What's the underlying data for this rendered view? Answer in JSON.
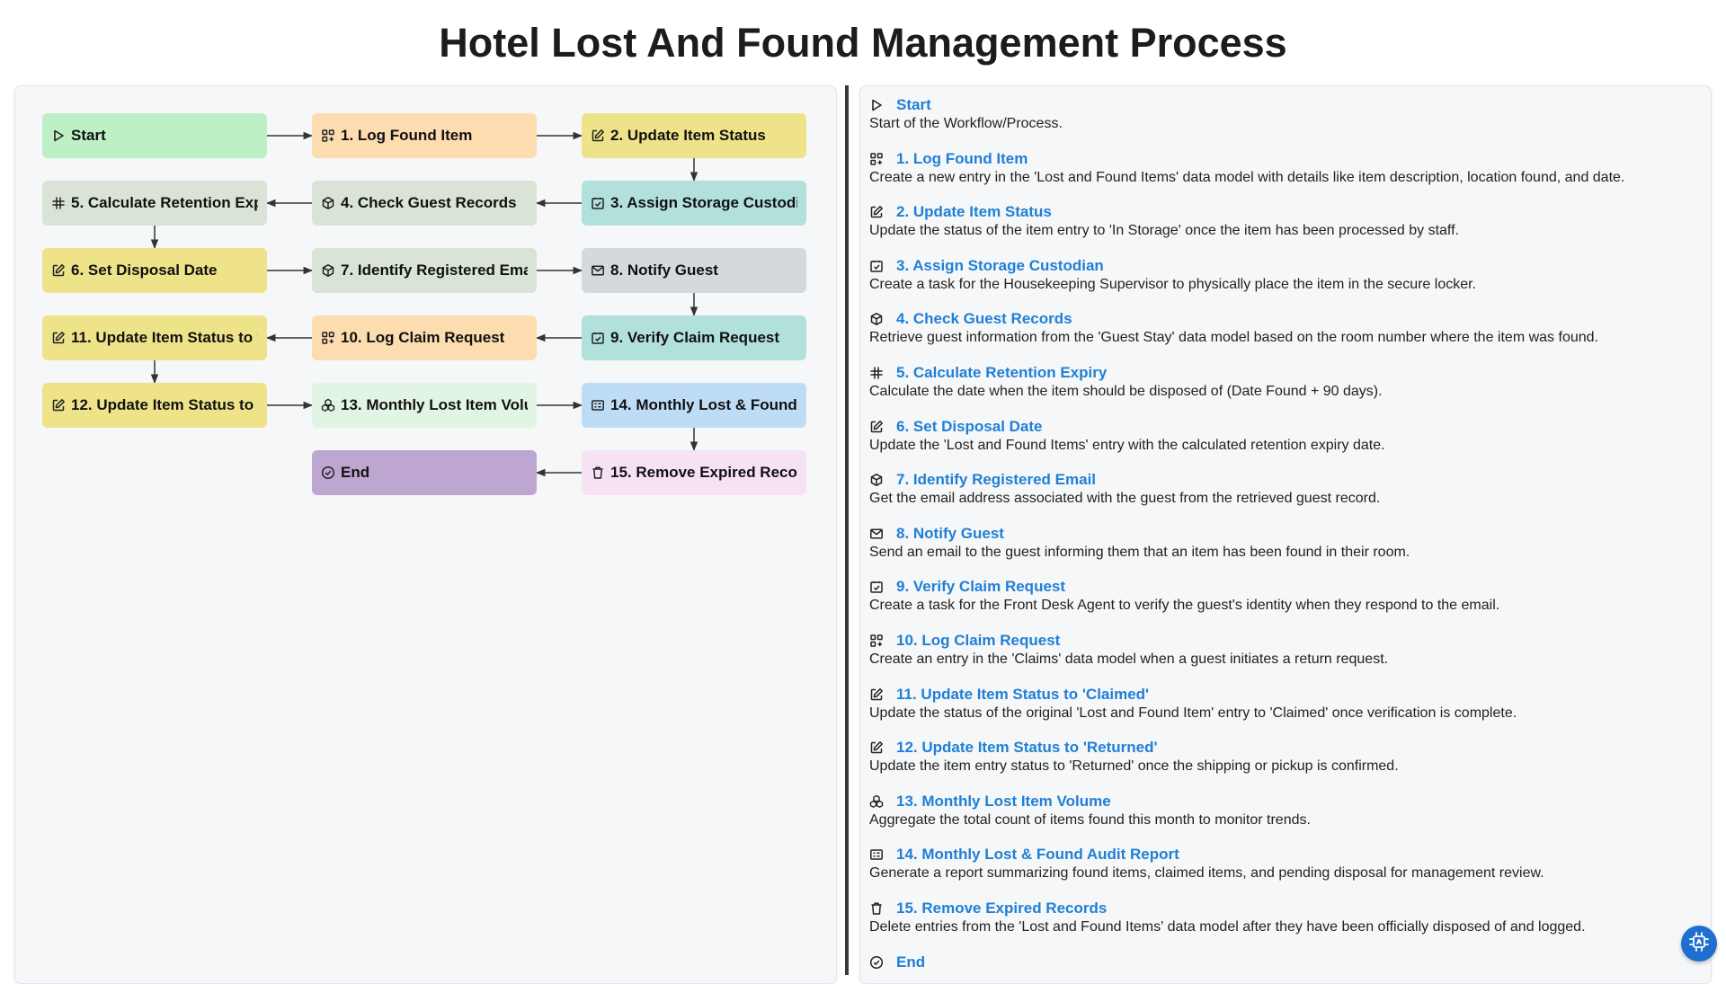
{
  "title": "Hotel Lost And Found Management Process",
  "colors": {
    "green": "#bdf0c4",
    "orange": "#fddcb0",
    "yellow": "#efe38a",
    "teal": "#b2e0da",
    "sage": "#d9e4d6",
    "gray": "#d4d9dd",
    "mint": "#e2f4e4",
    "blue": "#bfdcf7",
    "pink": "#f7e2f4",
    "purple": "#bda6d0",
    "link": "#1f7fd6"
  },
  "nodes": [
    {
      "id": "start",
      "label": "Start",
      "icon": "play-icon",
      "color": "green"
    },
    {
      "id": "n1",
      "label": "1. Log Found Item",
      "icon": "grid-plus-icon",
      "color": "orange"
    },
    {
      "id": "n2",
      "label": "2. Update Item Status",
      "icon": "edit-icon",
      "color": "yellow"
    },
    {
      "id": "n3",
      "label": "3. Assign Storage Custodian",
      "icon": "check-square-icon",
      "color": "teal"
    },
    {
      "id": "n4",
      "label": "4. Check Guest Records",
      "icon": "cube-icon",
      "color": "sage"
    },
    {
      "id": "n5",
      "label": "5. Calculate Retention Expiry",
      "icon": "hash-icon",
      "color": "sage"
    },
    {
      "id": "n6",
      "label": "6. Set Disposal Date",
      "icon": "edit-icon",
      "color": "yellow"
    },
    {
      "id": "n7",
      "label": "7. Identify Registered Email",
      "icon": "cube-icon",
      "color": "sage"
    },
    {
      "id": "n8",
      "label": "8. Notify Guest",
      "icon": "mail-icon",
      "color": "gray"
    },
    {
      "id": "n9",
      "label": "9. Verify Claim Request",
      "icon": "check-square-icon",
      "color": "teal"
    },
    {
      "id": "n10",
      "label": "10. Log Claim Request",
      "icon": "grid-plus-icon",
      "color": "orange"
    },
    {
      "id": "n11",
      "label": "11. Update Item Status to 'Claimed'",
      "icon": "edit-icon",
      "color": "yellow"
    },
    {
      "id": "n12",
      "label": "12. Update Item Status to 'Returned'",
      "icon": "edit-icon",
      "color": "yellow"
    },
    {
      "id": "n13",
      "label": "13. Monthly Lost Item Volume",
      "icon": "boxes-icon",
      "color": "mint"
    },
    {
      "id": "n14",
      "label": "14. Monthly Lost & Found Audit Report",
      "icon": "report-icon",
      "color": "blue"
    },
    {
      "id": "n15",
      "label": "15. Remove Expired Records",
      "icon": "trash-icon",
      "color": "pink"
    },
    {
      "id": "end",
      "label": "End",
      "icon": "check-circle-icon",
      "color": "purple"
    }
  ],
  "edges": [
    [
      "start",
      "n1"
    ],
    [
      "n1",
      "n2"
    ],
    [
      "n2",
      "n3"
    ],
    [
      "n3",
      "n4"
    ],
    [
      "n4",
      "n5"
    ],
    [
      "n5",
      "n6"
    ],
    [
      "n6",
      "n7"
    ],
    [
      "n7",
      "n8"
    ],
    [
      "n8",
      "n9"
    ],
    [
      "n9",
      "n10"
    ],
    [
      "n10",
      "n11"
    ],
    [
      "n11",
      "n12"
    ],
    [
      "n12",
      "n13"
    ],
    [
      "n13",
      "n14"
    ],
    [
      "n14",
      "n15"
    ],
    [
      "n15",
      "end"
    ]
  ],
  "steps": [
    {
      "title": "Start",
      "icon": "play-icon",
      "desc": "Start of the Workflow/Process."
    },
    {
      "title": "1. Log Found Item",
      "icon": "grid-plus-icon",
      "desc": "Create a new entry in the 'Lost and Found Items' data model with details like item description, location found, and date."
    },
    {
      "title": "2. Update Item Status",
      "icon": "edit-icon",
      "desc": "Update the status of the item entry to 'In Storage' once the item has been processed by staff."
    },
    {
      "title": "3. Assign Storage Custodian",
      "icon": "check-square-icon",
      "desc": "Create a task for the Housekeeping Supervisor to physically place the item in the secure locker."
    },
    {
      "title": "4. Check Guest Records",
      "icon": "cube-icon",
      "desc": "Retrieve guest information from the 'Guest Stay' data model based on the room number where the item was found."
    },
    {
      "title": "5. Calculate Retention Expiry",
      "icon": "hash-icon",
      "desc": "Calculate the date when the item should be disposed of (Date Found + 90 days)."
    },
    {
      "title": "6. Set Disposal Date",
      "icon": "edit-icon",
      "desc": "Update the 'Lost and Found Items' entry with the calculated retention expiry date."
    },
    {
      "title": "7. Identify Registered Email",
      "icon": "cube-icon",
      "desc": "Get the email address associated with the guest from the retrieved guest record."
    },
    {
      "title": "8. Notify Guest",
      "icon": "mail-icon",
      "desc": "Send an email to the guest informing them that an item has been found in their room."
    },
    {
      "title": "9. Verify Claim Request",
      "icon": "check-square-icon",
      "desc": "Create a task for the Front Desk Agent to verify the guest's identity when they respond to the email."
    },
    {
      "title": "10. Log Claim Request",
      "icon": "grid-plus-icon",
      "desc": "Create an entry in the 'Claims' data model when a guest initiates a return request."
    },
    {
      "title": "11. Update Item Status to 'Claimed'",
      "icon": "edit-icon",
      "desc": "Update the status of the original 'Lost and Found Item' entry to 'Claimed' once verification is complete."
    },
    {
      "title": "12. Update Item Status to 'Returned'",
      "icon": "edit-icon",
      "desc": "Update the item entry status to 'Returned' once the shipping or pickup is confirmed."
    },
    {
      "title": "13. Monthly Lost Item Volume",
      "icon": "boxes-icon",
      "desc": "Aggregate the total count of items found this month to monitor trends."
    },
    {
      "title": "14. Monthly Lost & Found Audit Report",
      "icon": "report-icon",
      "desc": "Generate a report summarizing found items, claimed items, and pending disposal for management review."
    },
    {
      "title": "15. Remove Expired Records",
      "icon": "trash-icon",
      "desc": "Delete entries from the 'Lost and Found Items' data model after they have been officially disposed of and logged."
    },
    {
      "title": "End",
      "icon": "check-circle-icon",
      "desc": ""
    }
  ]
}
